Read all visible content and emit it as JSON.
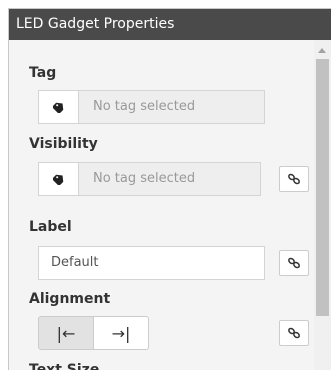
{
  "panel": {
    "title": "LED Gadget Properties"
  },
  "tag": {
    "label": "Tag",
    "placeholder": "No tag selected",
    "icon": "tag-icon"
  },
  "visibility": {
    "label": "Visibility",
    "placeholder": "No tag selected",
    "icon": "tag-icon",
    "link_icon": "link-icon"
  },
  "label_field": {
    "label": "Label",
    "value": "Default",
    "link_icon": "link-icon"
  },
  "alignment": {
    "label": "Alignment",
    "options": [
      "|←",
      "→|"
    ],
    "selected": "left",
    "link_icon": "link-icon"
  },
  "text_size": {
    "label": "Text Size"
  }
}
